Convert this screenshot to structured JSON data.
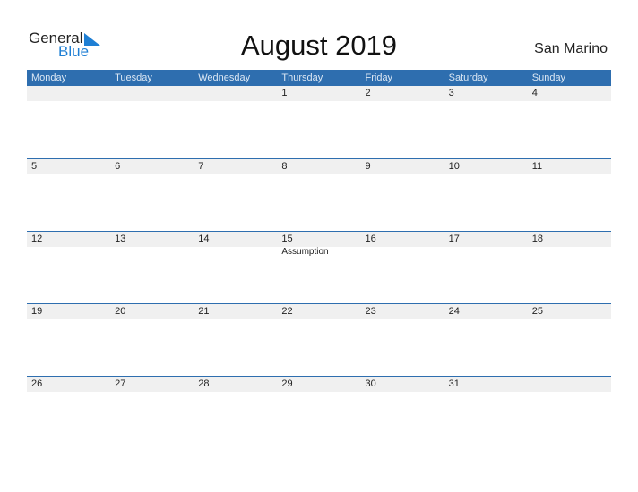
{
  "logo": {
    "general": "General",
    "blue": "Blue"
  },
  "title": "August 2019",
  "country": "San Marino",
  "weekdays": [
    "Monday",
    "Tuesday",
    "Wednesday",
    "Thursday",
    "Friday",
    "Saturday",
    "Sunday"
  ],
  "weeks": [
    {
      "days": [
        "",
        "",
        "",
        "1",
        "2",
        "3",
        "4"
      ],
      "events": [
        "",
        "",
        "",
        "",
        "",
        "",
        ""
      ]
    },
    {
      "days": [
        "5",
        "6",
        "7",
        "8",
        "9",
        "10",
        "11"
      ],
      "events": [
        "",
        "",
        "",
        "",
        "",
        "",
        ""
      ]
    },
    {
      "days": [
        "12",
        "13",
        "14",
        "15",
        "16",
        "17",
        "18"
      ],
      "events": [
        "",
        "",
        "",
        "Assumption",
        "",
        "",
        ""
      ]
    },
    {
      "days": [
        "19",
        "20",
        "21",
        "22",
        "23",
        "24",
        "25"
      ],
      "events": [
        "",
        "",
        "",
        "",
        "",
        "",
        ""
      ]
    },
    {
      "days": [
        "26",
        "27",
        "28",
        "29",
        "30",
        "31",
        ""
      ],
      "events": [
        "",
        "",
        "",
        "",
        "",
        "",
        ""
      ]
    }
  ],
  "colors": {
    "header": "#2e6eaf",
    "strip": "#f0f0f0",
    "brand_blue": "#1f7fd4"
  }
}
